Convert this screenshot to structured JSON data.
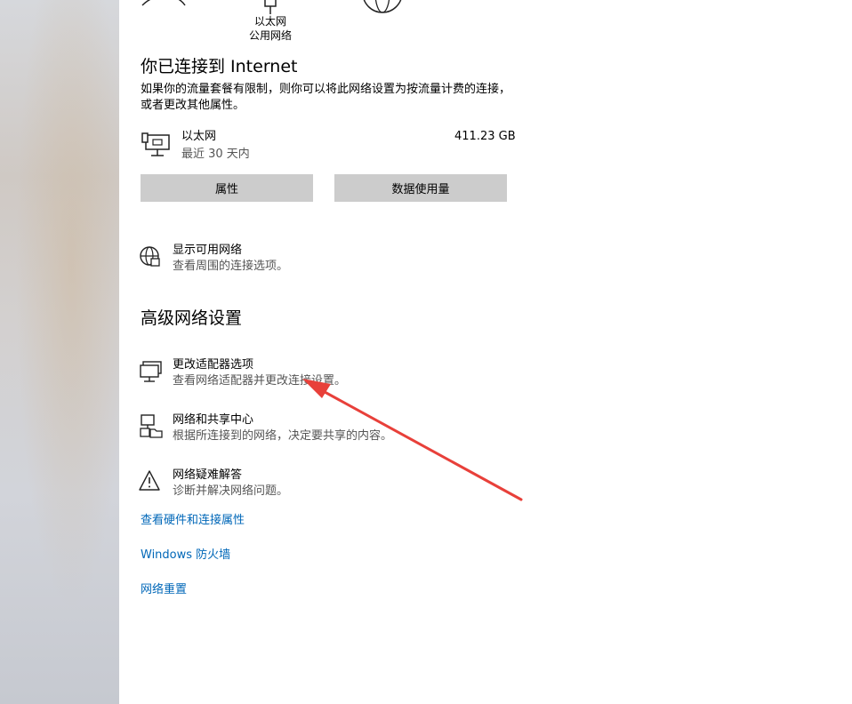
{
  "status": {
    "center_label_line1": "以太网",
    "center_label_line2": "公用网络"
  },
  "connection": {
    "heading": "你已连接到 Internet",
    "description": "如果你的流量套餐有限制，则你可以将此网络设置为按流量计费的连接，或者更改其他属性。",
    "adapter_name": "以太网",
    "period": "最近 30 天内",
    "usage": "411.23 GB",
    "properties_button": "属性",
    "data_usage_button": "数据使用量"
  },
  "show_networks": {
    "title": "显示可用网络",
    "subtitle": "查看周围的连接选项。",
    "icon": "globe-network-icon"
  },
  "advanced": {
    "heading": "高级网络设置",
    "items": [
      {
        "title": "更改适配器选项",
        "subtitle": "查看网络适配器并更改连接设置。",
        "icon": "adapter-monitor-icon"
      },
      {
        "title": "网络和共享中心",
        "subtitle": "根据所连接到的网络，决定要共享的内容。",
        "icon": "sharing-center-icon"
      },
      {
        "title": "网络疑难解答",
        "subtitle": "诊断并解决网络问题。",
        "icon": "warning-triangle-icon"
      }
    ]
  },
  "links": [
    "查看硬件和连接属性",
    "Windows 防火墙",
    "网络重置"
  ],
  "annotation": {
    "arrow_color": "#e8403a"
  },
  "colors": {
    "link": "#0067b8",
    "button_bg": "#cccccc"
  }
}
